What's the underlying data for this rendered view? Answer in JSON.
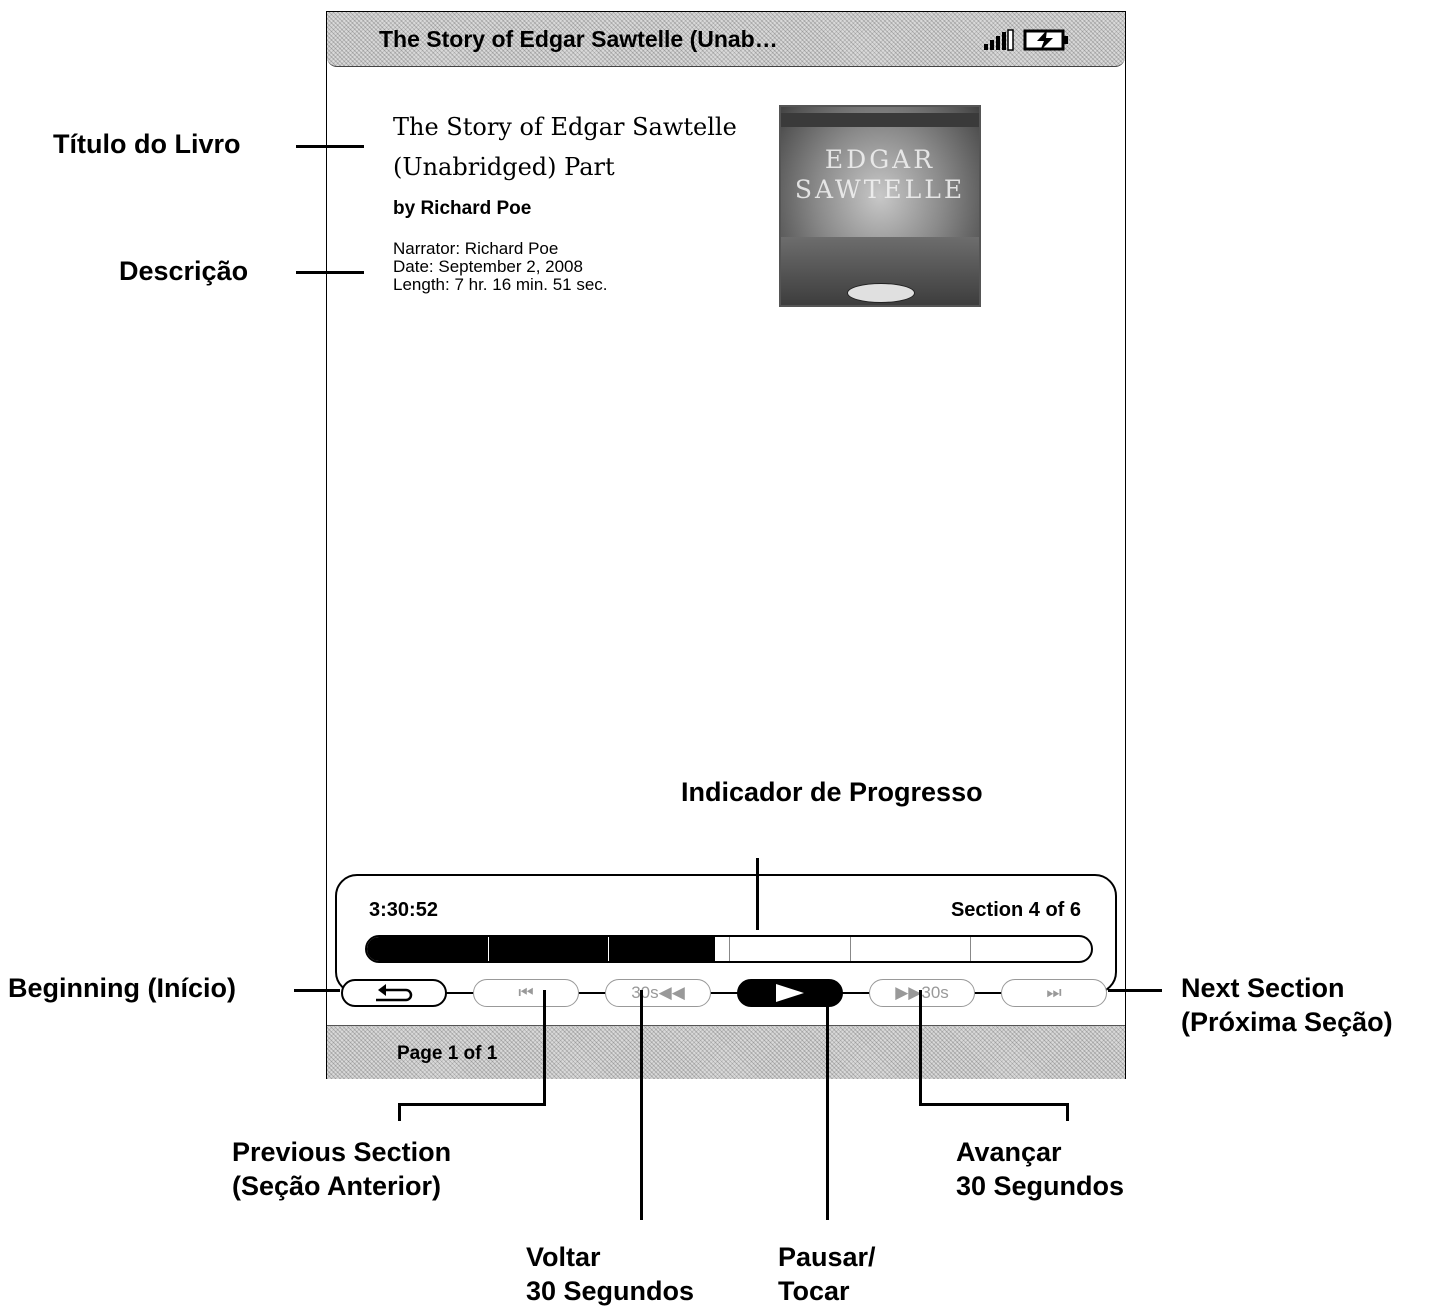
{
  "status_bar": {
    "title": "The Story of Edgar Sawtelle (Unab…"
  },
  "book": {
    "title": "The Story of Edgar Sawtelle (Unabridged) Part",
    "author": "by Richard Poe",
    "narrator": "Narrator: Richard Poe",
    "date": "Date: September 2, 2008",
    "length": "Length: 7 hr. 16 min. 51 sec.",
    "cover_text": "EDGAR SAWTELLE"
  },
  "player": {
    "elapsed": "3:30:52",
    "section_label": "Section 4 of 6",
    "sections_total": 6,
    "progress_fraction": 0.48,
    "buttons": {
      "previous_section": "⏮",
      "back_30": "30s◀◀",
      "forward_30": "▶▶30s",
      "next_section": "⏭"
    }
  },
  "footer": {
    "page": "Page 1 of 1"
  },
  "annotations": {
    "book_title": "Título do Livro",
    "description": "Descrição",
    "progress": "Indicador de Progresso",
    "beginning": "Beginning (Início)",
    "next_section": [
      "Next Section",
      "(Próxima Seção)"
    ],
    "previous_section": [
      "Previous Section",
      "(Seção Anterior)"
    ],
    "forward_30": [
      "Avançar",
      "30 Segundos"
    ],
    "back_30": [
      "Voltar",
      "30 Segundos"
    ],
    "play_pause": [
      "Pausar/",
      "Tocar"
    ]
  },
  "colors": {
    "disabled": "#999999",
    "active": "#000000",
    "bar": "#d9d9d9"
  }
}
